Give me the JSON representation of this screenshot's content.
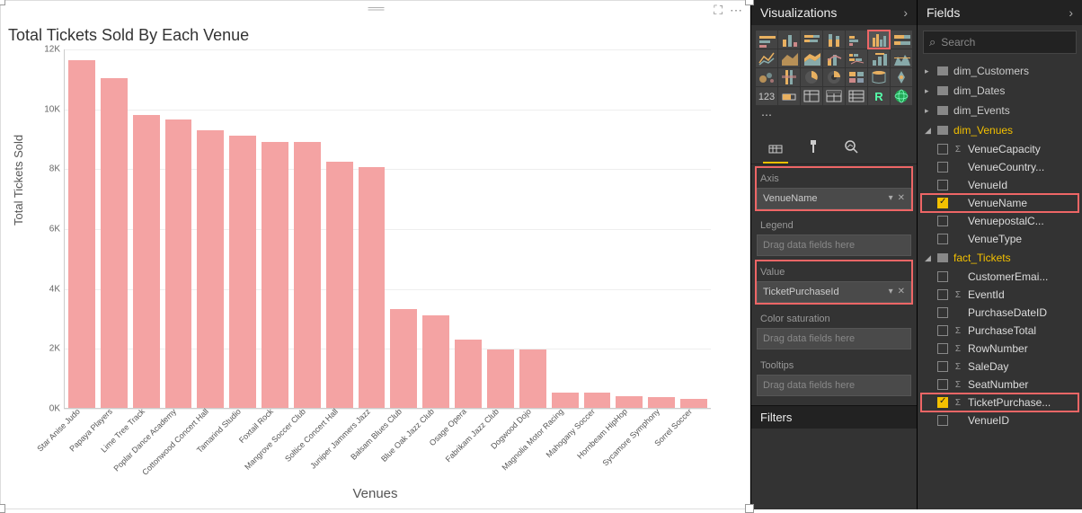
{
  "chart_data": {
    "type": "bar",
    "title": "Total Tickets Sold By Each Venue",
    "xlabel": "Venues",
    "ylabel": "Total Tickets Sold",
    "ylim": [
      0,
      12000
    ],
    "yticks": [
      0,
      2000,
      4000,
      6000,
      8000,
      10000,
      12000
    ],
    "ytick_labels": [
      "0K",
      "2K",
      "4K",
      "6K",
      "8K",
      "10K",
      "12K"
    ],
    "categories": [
      "Star Anise Judo",
      "Papaya Players",
      "Lime Tree Track",
      "Poplar Dance Academy",
      "Cottonwood Concert Hall",
      "Tamarind Studio",
      "Foxtail Rock",
      "Mangrove Soccer Club",
      "Soltice Concert Hall",
      "Juniper Jammers Jazz",
      "Balsam Blues Club",
      "Blue Oak Jazz Club",
      "Osage Opera",
      "Fabrikam Jazz Club",
      "Dogwood Dojo",
      "Magnolia Motor Racing",
      "Mahogany Soccer",
      "Hornbeam HipHop",
      "Sycamore Symphony",
      "Sorrel Soccer"
    ],
    "values": [
      11650,
      11050,
      9800,
      9650,
      9300,
      9100,
      8900,
      8900,
      8250,
      8050,
      3300,
      3100,
      2300,
      1950,
      1950,
      500,
      500,
      400,
      350,
      300
    ],
    "bar_color": "#f4a3a3"
  },
  "vis_panel": {
    "title": "Visualizations",
    "wells": {
      "axis": {
        "label": "Axis",
        "value": "VenueName"
      },
      "legend": {
        "label": "Legend",
        "placeholder": "Drag data fields here"
      },
      "value": {
        "label": "Value",
        "value": "TicketPurchaseId"
      },
      "color": {
        "label": "Color saturation",
        "placeholder": "Drag data fields here"
      },
      "tooltips": {
        "label": "Tooltips",
        "placeholder": "Drag data fields here"
      }
    },
    "filters_label": "Filters"
  },
  "fields_panel": {
    "title": "Fields",
    "search_placeholder": "Search",
    "tables": [
      {
        "name": "dim_Customers",
        "expanded": false
      },
      {
        "name": "dim_Dates",
        "expanded": false
      },
      {
        "name": "dim_Events",
        "expanded": false
      },
      {
        "name": "dim_Venues",
        "expanded": true,
        "highlight": true,
        "fields": [
          {
            "name": "VenueCapacity",
            "checked": false,
            "sigma": true
          },
          {
            "name": "VenueCountry...",
            "checked": false
          },
          {
            "name": "VenueId",
            "checked": false
          },
          {
            "name": "VenueName",
            "checked": true,
            "highlight": true
          },
          {
            "name": "VenuepostalC...",
            "checked": false
          },
          {
            "name": "VenueType",
            "checked": false
          }
        ]
      },
      {
        "name": "fact_Tickets",
        "expanded": true,
        "highlight": true,
        "fields": [
          {
            "name": "CustomerEmai...",
            "checked": false
          },
          {
            "name": "EventId",
            "checked": false,
            "sigma": true
          },
          {
            "name": "PurchaseDateID",
            "checked": false
          },
          {
            "name": "PurchaseTotal",
            "checked": false,
            "sigma": true
          },
          {
            "name": "RowNumber",
            "checked": false,
            "sigma": true
          },
          {
            "name": "SaleDay",
            "checked": false,
            "sigma": true
          },
          {
            "name": "SeatNumber",
            "checked": false,
            "sigma": true
          },
          {
            "name": "TicketPurchase...",
            "checked": true,
            "sigma": true,
            "highlight": true
          },
          {
            "name": "VenueID",
            "checked": false
          }
        ]
      }
    ]
  }
}
